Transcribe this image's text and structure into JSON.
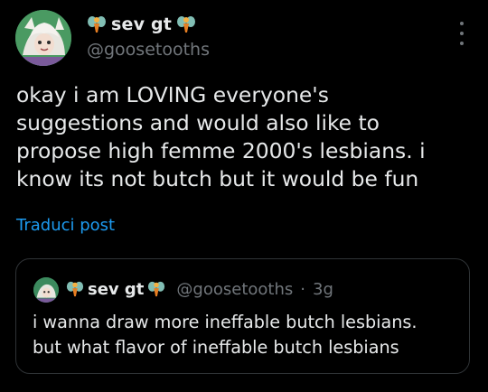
{
  "author": {
    "display_name": "sev gt",
    "handle": "@goosetooths",
    "name_emoji": "fairy-emoji"
  },
  "post": {
    "text": "okay i am LOVING everyone's\nsuggestions and would also like to\npropose high femme 2000's lesbians. i\nknow its not butch but it would be fun",
    "translate_label": "Traduci post"
  },
  "quoted_post": {
    "display_name": "sev gt",
    "handle": "@goosetooths",
    "separator": "·",
    "time": "3g",
    "text": "i wanna draw more ineffable butch lesbians.\nbut what flavor of ineffable butch lesbians"
  },
  "icons": {
    "more": "more-options-icon",
    "emoji": "fairy-emoji"
  },
  "colors": {
    "background": "#000000",
    "text": "#e7e9ea",
    "secondary": "#71767b",
    "link": "#1d9bf0",
    "border": "#2f3336"
  }
}
